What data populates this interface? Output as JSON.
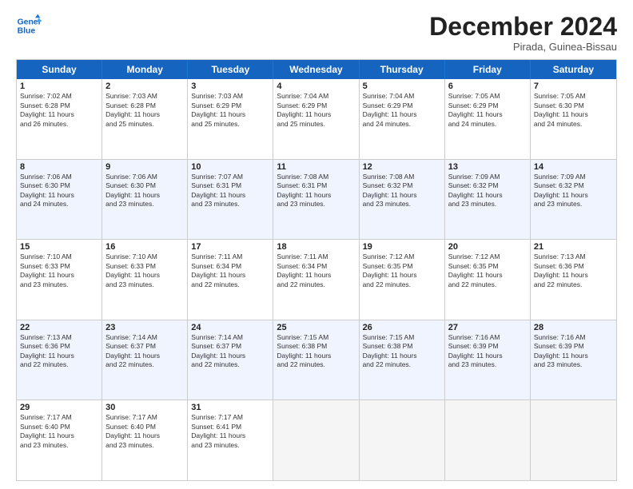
{
  "logo": {
    "line1": "General",
    "line2": "Blue"
  },
  "title": "December 2024",
  "location": "Pirada, Guinea-Bissau",
  "days_of_week": [
    "Sunday",
    "Monday",
    "Tuesday",
    "Wednesday",
    "Thursday",
    "Friday",
    "Saturday"
  ],
  "weeks": [
    [
      {
        "day": 1,
        "info": "Sunrise: 7:02 AM\nSunset: 6:28 PM\nDaylight: 11 hours\nand 26 minutes."
      },
      {
        "day": 2,
        "info": "Sunrise: 7:03 AM\nSunset: 6:28 PM\nDaylight: 11 hours\nand 25 minutes."
      },
      {
        "day": 3,
        "info": "Sunrise: 7:03 AM\nSunset: 6:29 PM\nDaylight: 11 hours\nand 25 minutes."
      },
      {
        "day": 4,
        "info": "Sunrise: 7:04 AM\nSunset: 6:29 PM\nDaylight: 11 hours\nand 25 minutes."
      },
      {
        "day": 5,
        "info": "Sunrise: 7:04 AM\nSunset: 6:29 PM\nDaylight: 11 hours\nand 24 minutes."
      },
      {
        "day": 6,
        "info": "Sunrise: 7:05 AM\nSunset: 6:29 PM\nDaylight: 11 hours\nand 24 minutes."
      },
      {
        "day": 7,
        "info": "Sunrise: 7:05 AM\nSunset: 6:30 PM\nDaylight: 11 hours\nand 24 minutes."
      }
    ],
    [
      {
        "day": 8,
        "info": "Sunrise: 7:06 AM\nSunset: 6:30 PM\nDaylight: 11 hours\nand 24 minutes."
      },
      {
        "day": 9,
        "info": "Sunrise: 7:06 AM\nSunset: 6:30 PM\nDaylight: 11 hours\nand 23 minutes."
      },
      {
        "day": 10,
        "info": "Sunrise: 7:07 AM\nSunset: 6:31 PM\nDaylight: 11 hours\nand 23 minutes."
      },
      {
        "day": 11,
        "info": "Sunrise: 7:08 AM\nSunset: 6:31 PM\nDaylight: 11 hours\nand 23 minutes."
      },
      {
        "day": 12,
        "info": "Sunrise: 7:08 AM\nSunset: 6:32 PM\nDaylight: 11 hours\nand 23 minutes."
      },
      {
        "day": 13,
        "info": "Sunrise: 7:09 AM\nSunset: 6:32 PM\nDaylight: 11 hours\nand 23 minutes."
      },
      {
        "day": 14,
        "info": "Sunrise: 7:09 AM\nSunset: 6:32 PM\nDaylight: 11 hours\nand 23 minutes."
      }
    ],
    [
      {
        "day": 15,
        "info": "Sunrise: 7:10 AM\nSunset: 6:33 PM\nDaylight: 11 hours\nand 23 minutes."
      },
      {
        "day": 16,
        "info": "Sunrise: 7:10 AM\nSunset: 6:33 PM\nDaylight: 11 hours\nand 23 minutes."
      },
      {
        "day": 17,
        "info": "Sunrise: 7:11 AM\nSunset: 6:34 PM\nDaylight: 11 hours\nand 22 minutes."
      },
      {
        "day": 18,
        "info": "Sunrise: 7:11 AM\nSunset: 6:34 PM\nDaylight: 11 hours\nand 22 minutes."
      },
      {
        "day": 19,
        "info": "Sunrise: 7:12 AM\nSunset: 6:35 PM\nDaylight: 11 hours\nand 22 minutes."
      },
      {
        "day": 20,
        "info": "Sunrise: 7:12 AM\nSunset: 6:35 PM\nDaylight: 11 hours\nand 22 minutes."
      },
      {
        "day": 21,
        "info": "Sunrise: 7:13 AM\nSunset: 6:36 PM\nDaylight: 11 hours\nand 22 minutes."
      }
    ],
    [
      {
        "day": 22,
        "info": "Sunrise: 7:13 AM\nSunset: 6:36 PM\nDaylight: 11 hours\nand 22 minutes."
      },
      {
        "day": 23,
        "info": "Sunrise: 7:14 AM\nSunset: 6:37 PM\nDaylight: 11 hours\nand 22 minutes."
      },
      {
        "day": 24,
        "info": "Sunrise: 7:14 AM\nSunset: 6:37 PM\nDaylight: 11 hours\nand 22 minutes."
      },
      {
        "day": 25,
        "info": "Sunrise: 7:15 AM\nSunset: 6:38 PM\nDaylight: 11 hours\nand 22 minutes."
      },
      {
        "day": 26,
        "info": "Sunrise: 7:15 AM\nSunset: 6:38 PM\nDaylight: 11 hours\nand 22 minutes."
      },
      {
        "day": 27,
        "info": "Sunrise: 7:16 AM\nSunset: 6:39 PM\nDaylight: 11 hours\nand 23 minutes."
      },
      {
        "day": 28,
        "info": "Sunrise: 7:16 AM\nSunset: 6:39 PM\nDaylight: 11 hours\nand 23 minutes."
      }
    ],
    [
      {
        "day": 29,
        "info": "Sunrise: 7:17 AM\nSunset: 6:40 PM\nDaylight: 11 hours\nand 23 minutes."
      },
      {
        "day": 30,
        "info": "Sunrise: 7:17 AM\nSunset: 6:40 PM\nDaylight: 11 hours\nand 23 minutes."
      },
      {
        "day": 31,
        "info": "Sunrise: 7:17 AM\nSunset: 6:41 PM\nDaylight: 11 hours\nand 23 minutes."
      },
      {
        "day": null,
        "info": ""
      },
      {
        "day": null,
        "info": ""
      },
      {
        "day": null,
        "info": ""
      },
      {
        "day": null,
        "info": ""
      }
    ]
  ]
}
